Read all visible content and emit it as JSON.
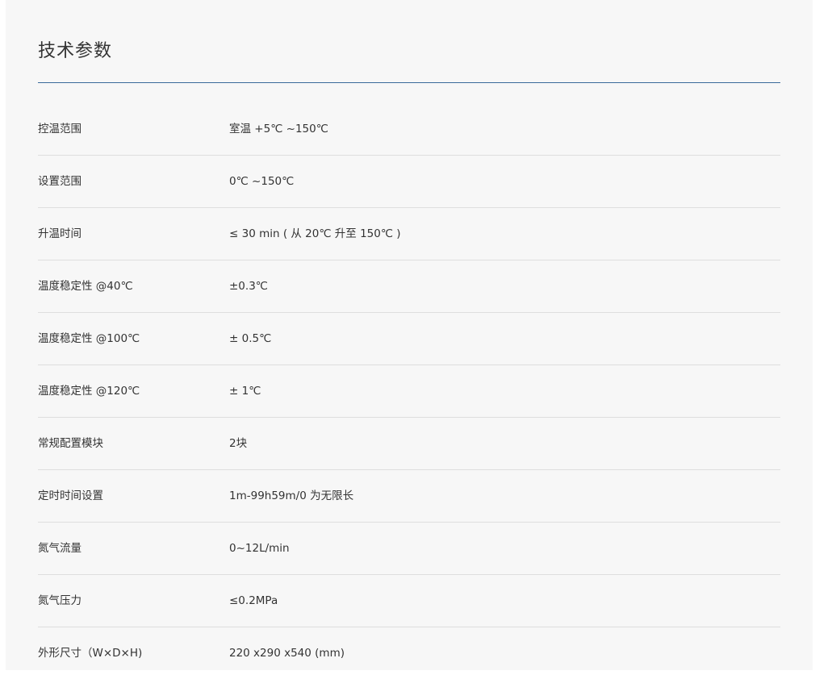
{
  "section": {
    "title": "技术参数"
  },
  "specs": [
    {
      "label": "控温范围",
      "value": "室温 +5℃ ~150℃"
    },
    {
      "label": "设置范围",
      "value": "0℃ ~150℃"
    },
    {
      "label": "升温时间",
      "value": "≤ 30 min ( 从 20℃ 升至 150℃ )"
    },
    {
      "label": "温度稳定性 @40℃",
      "value": "±0.3℃"
    },
    {
      "label": "温度稳定性 @100℃",
      "value": "± 0.5℃"
    },
    {
      "label": "温度稳定性 @120℃",
      "value": "± 1℃"
    },
    {
      "label": "常规配置模块",
      "value": "2块"
    },
    {
      "label": "定时时间设置",
      "value": "1m-99h59m/0 为无限长"
    },
    {
      "label": "氮气流量",
      "value": "0~12L/min"
    },
    {
      "label": "氮气压力",
      "value": "≤0.2MPa"
    },
    {
      "label": "外形尺寸（W×D×H)",
      "value": "220 x290 x540 (mm)"
    }
  ]
}
